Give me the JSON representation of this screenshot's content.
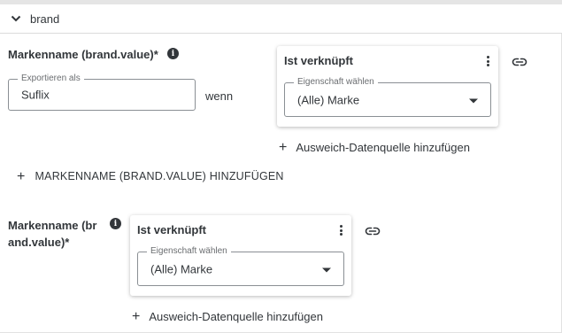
{
  "section": {
    "title": "brand",
    "icon": "chevron-down-icon"
  },
  "row1": {
    "label": "Markenname (brand.value)*",
    "info_icon": "info-icon",
    "export_field": {
      "legend": "Exportieren als",
      "value": "Suflix"
    },
    "condition_word": "wenn",
    "card": {
      "title": "Ist verknüpft",
      "menu_icon": "more-vertical-icon",
      "select": {
        "legend": "Eigenschaft wählen",
        "value": "(Alle) Marke"
      }
    },
    "link_icon": "link-icon",
    "fallback_link": "Ausweich-Datenquelle hinzufügen"
  },
  "add_brand_button": "MARKENNAME (BRAND.VALUE) HINZUFÜGEN",
  "row2": {
    "label_line1": "Markenname (br",
    "label_line2": "and.value)*",
    "info_icon": "info-icon",
    "card": {
      "title": "Ist verknüpft",
      "menu_icon": "more-vertical-icon",
      "select": {
        "legend": "Eigenschaft wählen",
        "value": "(Alle) Marke"
      }
    },
    "link_icon": "link-icon",
    "fallback_link": "Ausweich-Datenquelle hinzufügen"
  },
  "colors": {
    "text": "#32363a",
    "border": "#8a8f94",
    "divider": "#dcdcdc"
  }
}
